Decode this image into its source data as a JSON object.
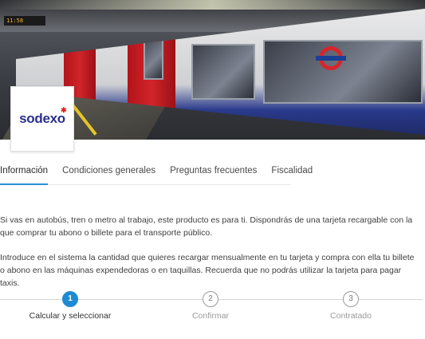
{
  "hero": {
    "sign_text": "11:58",
    "logo": {
      "text": "sodexo",
      "brand_color": "#2a2f8c",
      "star_color": "#e1251b"
    }
  },
  "tabs": [
    {
      "label": "Información",
      "active": true
    },
    {
      "label": "Condiciones generales",
      "active": false
    },
    {
      "label": "Preguntas frecuentes",
      "active": false
    },
    {
      "label": "Fiscalidad",
      "active": false
    }
  ],
  "content": {
    "paragraph_1": "Si vas en autobús, tren o metro al trabajo, este producto es para ti. Dispondrás de una tarjeta recargable con la que comprar tu abono o billete para el transporte público.",
    "paragraph_2": "Introduce en el sistema la cantidad que quieres recargar mensualmente en tu tarjeta y compra con ella tu billete o abono en las máquinas expendedoras o en taquillas. Recuerda que no podrás utilizar la tarjeta para pagar taxis."
  },
  "stepper": {
    "accent_color": "#1d8bd3",
    "steps": [
      {
        "number": "1",
        "label": "Calcular y seleccionar",
        "active": true
      },
      {
        "number": "2",
        "label": "Confirmar",
        "active": false
      },
      {
        "number": "3",
        "label": "Contratado",
        "active": false
      }
    ]
  }
}
